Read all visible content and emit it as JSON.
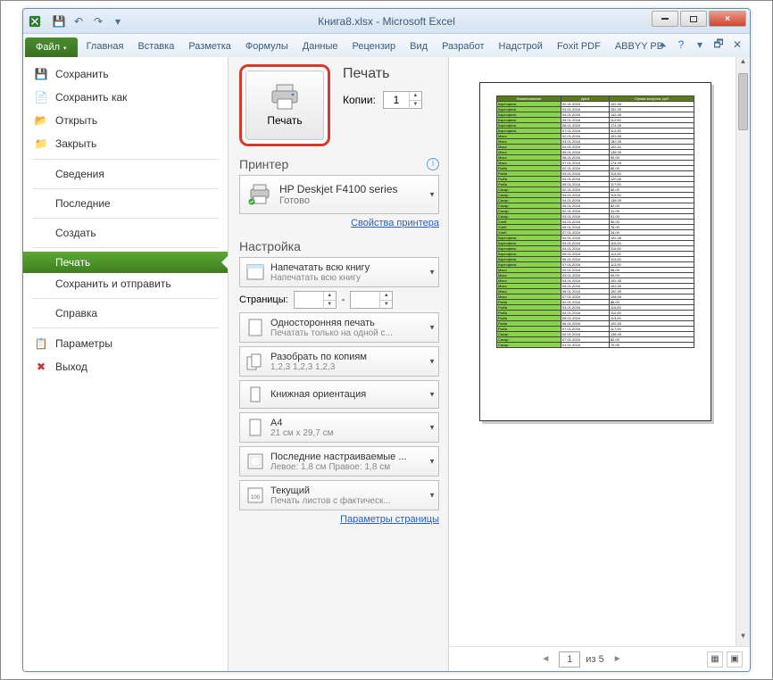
{
  "window": {
    "title": "Книга8.xlsx - Microsoft Excel"
  },
  "ribbon": {
    "tabs": [
      "Файл",
      "Главная",
      "Вставка",
      "Разметка",
      "Формулы",
      "Данные",
      "Рецензир",
      "Вид",
      "Разработ",
      "Надстрой",
      "Foxit PDF",
      "ABBYY PD"
    ]
  },
  "nav": {
    "items": [
      "Сохранить",
      "Сохранить как",
      "Открыть",
      "Закрыть",
      "Сведения",
      "Последние",
      "Создать",
      "Печать",
      "Сохранить и отправить",
      "Справка",
      "Параметры",
      "Выход"
    ]
  },
  "print": {
    "heading": "Печать",
    "button_label": "Печать",
    "copies_label": "Копии:",
    "copies_value": "1"
  },
  "printer": {
    "heading": "Принтер",
    "name": "HP Deskjet F4100 series",
    "status": "Готово",
    "properties_link": "Свойства принтера"
  },
  "settings": {
    "heading": "Настройка",
    "print_what": {
      "title": "Напечатать всю книгу",
      "sub": "Напечатать всю книгу"
    },
    "pages_label": "Страницы:",
    "sides": {
      "title": "Односторонняя печать",
      "sub": "Печатать только на одной с..."
    },
    "collate": {
      "title": "Разобрать по копиям",
      "sub": "1,2,3   1,2,3   1,2,3"
    },
    "orientation": {
      "title": "Книжная ориентация"
    },
    "paper": {
      "title": "A4",
      "sub": "21 см x 29,7 см"
    },
    "margins": {
      "title": "Последние настраиваемые ...",
      "sub": "Левое: 1,8 см   Правое: 1,8 см"
    },
    "scaling": {
      "title": "Текущий",
      "sub": "Печать листов с фактическ..."
    },
    "page_setup_link": "Параметры страницы"
  },
  "preview": {
    "current_page": "1",
    "of_label": "из",
    "total_pages": "5",
    "table_headers": [
      "Наименование",
      "Дата",
      "Сумма выручки, руб"
    ],
    "table_rows": [
      [
        "Картофель",
        "02.01.2016",
        "102,00"
      ],
      [
        "Картофель",
        "03.01.2016",
        "152,00"
      ],
      [
        "Картофель",
        "04.01.2016",
        "142,00"
      ],
      [
        "Картофель",
        "05.01.2016",
        "112,00"
      ],
      [
        "Картофель",
        "06.01.2016",
        "174,00"
      ],
      [
        "Картофель",
        "07.01.2016",
        "112,00"
      ],
      [
        "Мясо",
        "02.01.2016",
        "102,00"
      ],
      [
        "Мясо",
        "03.01.2016",
        "162,00"
      ],
      [
        "Мясо",
        "04.01.2016",
        "102,01"
      ],
      [
        "Мясо",
        "05.01.2016",
        "138,00"
      ],
      [
        "Мясо",
        "06.01.2016",
        "90,00"
      ],
      [
        "Мясо",
        "07.01.2016",
        "174,00"
      ],
      [
        "Рыба",
        "02.01.2016",
        "80,00"
      ],
      [
        "Рыба",
        "03.01.2016",
        "110,00"
      ],
      [
        "Рыба",
        "04.01.2016",
        "120,00"
      ],
      [
        "Рыба",
        "05.01.2016",
        "117,00"
      ],
      [
        "Сахар",
        "02.01.2016",
        "80,00"
      ],
      [
        "Сахар",
        "03.01.2016",
        "110,00"
      ],
      [
        "Сахар",
        "04.01.2016",
        "138,00"
      ],
      [
        "Сахар",
        "05.01.2016",
        "82,00"
      ],
      [
        "Сахар",
        "02.01.2016",
        "31,00"
      ],
      [
        "Сахар",
        "03.01.2016",
        "51,00"
      ],
      [
        "Хлеб",
        "04.01.2016",
        "90,00"
      ],
      [
        "Хлеб",
        "05.01.2016",
        "76,00"
      ],
      [
        "Хлеб",
        "07.01.2016",
        "34,00"
      ],
      [
        "Картофель",
        "02.01.2016",
        "102,00"
      ],
      [
        "Картофель",
        "03.01.2016",
        "110,00"
      ],
      [
        "Картофель",
        "04.01.2016",
        "110,00"
      ],
      [
        "Картофель",
        "05.01.2016",
        "112,00"
      ],
      [
        "Картофель",
        "06.01.2016",
        "110,00"
      ],
      [
        "Картофель",
        "07.01.2016",
        "112,00"
      ],
      [
        "Мясо",
        "02.01.2016",
        "98,00"
      ],
      [
        "Мясо",
        "03.01.2016",
        "90,00"
      ],
      [
        "Мясо",
        "04.01.2016",
        "102,00"
      ],
      [
        "Мясо",
        "05.01.2016",
        "102,00"
      ],
      [
        "Мясо",
        "06.01.2016",
        "102,00"
      ],
      [
        "Мясо",
        "07.01.2016",
        "108,00"
      ],
      [
        "Рыба",
        "02.01.2016",
        "86,00"
      ],
      [
        "Рыба",
        "03.01.2016",
        "110,00"
      ],
      [
        "Рыба",
        "04.01.2016",
        "112,00"
      ],
      [
        "Рыба",
        "05.01.2016",
        "113,00"
      ],
      [
        "Рыба",
        "06.01.2016",
        "102,00"
      ],
      [
        "Рыба",
        "07.01.2016",
        "117,00"
      ],
      [
        "Сахар",
        "02.01.2016",
        "138,00"
      ],
      [
        "Сахар",
        "07.01.2016",
        "82,00"
      ],
      [
        "Сахар",
        "01.01.2016",
        "70,00"
      ]
    ]
  }
}
